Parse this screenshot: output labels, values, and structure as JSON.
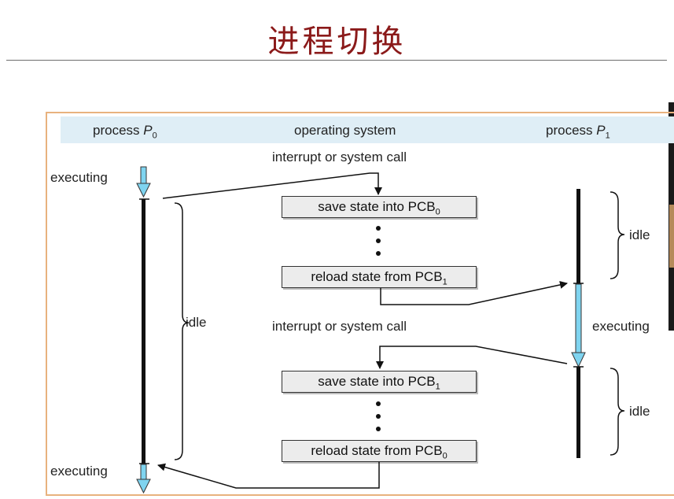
{
  "title": "进程切换",
  "headers": {
    "p0": "process",
    "p0_var": "P",
    "p0_sub": "0",
    "os": "operating system",
    "p1": "process",
    "p1_var": "P",
    "p1_sub": "1"
  },
  "labels": {
    "interrupt_top": "interrupt or system call",
    "interrupt_mid": "interrupt or system call",
    "executing_p0_top": "executing",
    "executing_p0_bottom": "executing",
    "executing_p1": "executing",
    "idle_p0": "idle",
    "idle_p1_top": "idle",
    "idle_p1_bottom": "idle"
  },
  "boxes": {
    "save_pcb0": {
      "text": "save state into PCB",
      "sub": "0"
    },
    "reload_pcb1": {
      "text": "reload state from PCB",
      "sub": "1"
    },
    "save_pcb1": {
      "text": "save state into PCB",
      "sub": "1"
    },
    "reload_pcb0": {
      "text": "reload state from PCB",
      "sub": "0"
    }
  },
  "colors": {
    "title": "#8b1a1a",
    "frame": "#e8b27e",
    "header_band": "#dfeef6",
    "executing_arrow": "#7fd4f0"
  }
}
